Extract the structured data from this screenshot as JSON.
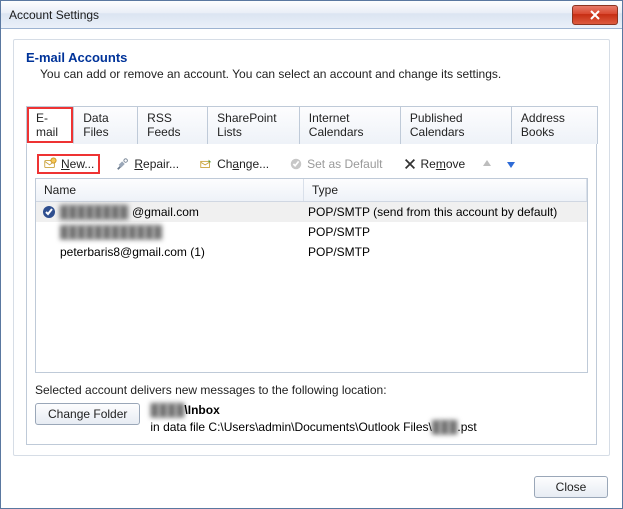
{
  "window": {
    "title": "Account Settings"
  },
  "header": {
    "title": "E-mail Accounts",
    "subtitle": "You can add or remove an account. You can select an account and change its settings."
  },
  "tabs": {
    "email": "E-mail",
    "datafiles": "Data Files",
    "rss": "RSS Feeds",
    "sharepoint": "SharePoint Lists",
    "ical": "Internet Calendars",
    "pubcal": "Published Calendars",
    "addr": "Address Books"
  },
  "toolbar": {
    "new": "New...",
    "repair": "Repair...",
    "change": "Change...",
    "setdefault": "Set as Default",
    "remove": "Remove"
  },
  "columns": {
    "name": "Name",
    "type": "Type"
  },
  "accounts": [
    {
      "name_obscured": "████████",
      "name_suffix": "@gmail.com",
      "type": "POP/SMTP (send from this account by default)",
      "is_default": true
    },
    {
      "name_obscured": "████████████",
      "name_suffix": "",
      "type": "POP/SMTP",
      "is_default": false
    },
    {
      "name_obscured": "",
      "name_suffix": "peterbaris8@gmail.com (1)",
      "type": "POP/SMTP",
      "is_default": false
    }
  ],
  "location": {
    "intro": "Selected account delivers new messages to the following location:",
    "change_folder": "Change Folder",
    "folder_prefix_obscured": "████",
    "folder_suffix": "\\Inbox",
    "path_prefix": "in data file C:\\Users\\admin\\Documents\\Outlook Files\\",
    "path_obscured": "███",
    "path_suffix": ".pst"
  },
  "footer": {
    "close": "Close"
  }
}
